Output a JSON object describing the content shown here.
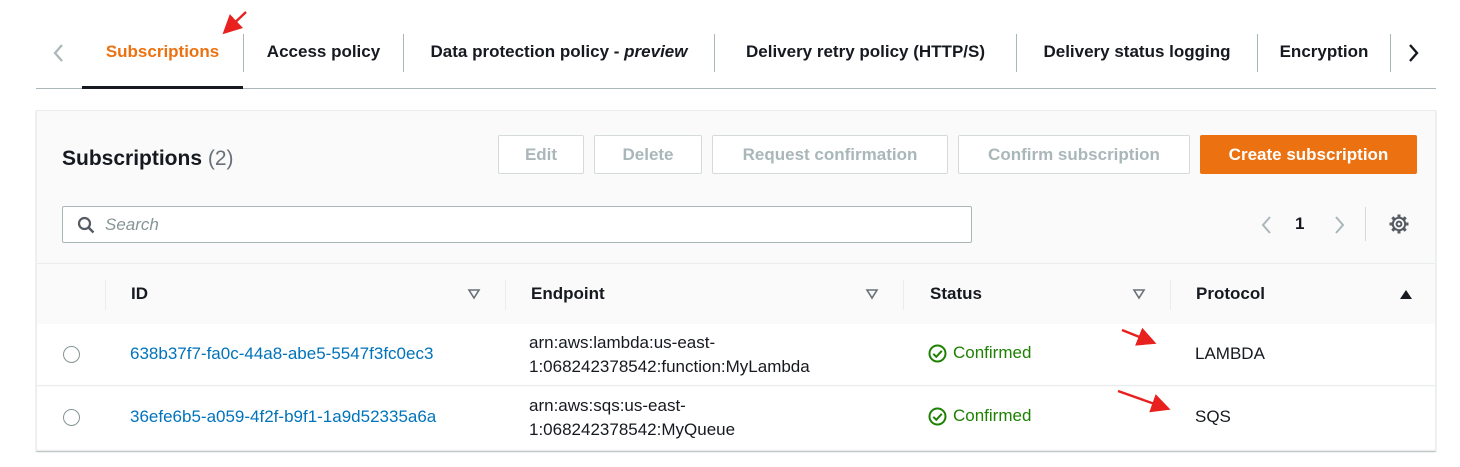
{
  "tabs": {
    "items": [
      {
        "label": "Subscriptions",
        "active": true
      },
      {
        "label": "Access policy",
        "active": false
      },
      {
        "label_main": "Data protection policy - ",
        "label_suffix": "preview",
        "active": false
      },
      {
        "label": "Delivery retry policy (HTTP/S)",
        "active": false
      },
      {
        "label": "Delivery status logging",
        "active": false
      },
      {
        "label": "Encryption",
        "active": false
      }
    ]
  },
  "panel": {
    "title": "Subscriptions",
    "count": "(2)",
    "buttons": {
      "edit": "Edit",
      "delete": "Delete",
      "request_confirmation": "Request confirmation",
      "confirm_subscription": "Confirm subscription",
      "create_subscription": "Create subscription"
    },
    "search": {
      "placeholder": "Search",
      "value": ""
    },
    "pagination": {
      "current_page": "1"
    }
  },
  "table": {
    "columns": {
      "id": "ID",
      "endpoint": "Endpoint",
      "status": "Status",
      "protocol": "Protocol"
    },
    "rows": [
      {
        "id": "638b37f7-fa0c-44a8-abe5-5547f3fc0ec3",
        "endpoint_line1": "arn:aws:lambda:us-east-",
        "endpoint_line2": "1:068242378542:function:MyLambda",
        "status": "Confirmed",
        "protocol": "LAMBDA"
      },
      {
        "id": "36efe6b5-a059-4f2f-b9f1-1a9d52335a6a",
        "endpoint_line1": "arn:aws:sqs:us-east-",
        "endpoint_line2": "1:068242378542:MyQueue",
        "status": "Confirmed",
        "protocol": "SQS"
      }
    ]
  },
  "colors": {
    "accent": "#ec7211",
    "link": "#0073bb",
    "success": "#1d8102",
    "annotation": "#e8201e"
  }
}
